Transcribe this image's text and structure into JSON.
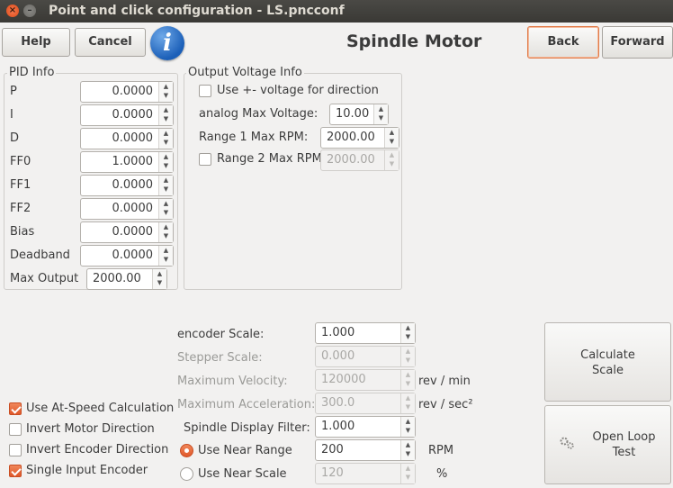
{
  "window": {
    "title": "Point and click configuration - LS.pncconf",
    "close_glyph": "×",
    "minimize_glyph": "–"
  },
  "toolbar": {
    "help_label": "Help",
    "cancel_label": "Cancel",
    "info_glyph": "i",
    "page_title": "Spindle Motor",
    "back_label": "Back",
    "forward_label": "Forward"
  },
  "pid": {
    "frame_label": "PID Info",
    "rows": [
      {
        "label": "P",
        "value": "0.0000"
      },
      {
        "label": "I",
        "value": "0.0000"
      },
      {
        "label": "D",
        "value": "0.0000"
      },
      {
        "label": "FF0",
        "value": "1.0000"
      },
      {
        "label": "FF1",
        "value": "0.0000"
      },
      {
        "label": "FF2",
        "value": "0.0000"
      },
      {
        "label": "Bias",
        "value": "0.0000"
      },
      {
        "label": "Deadband",
        "value": "0.0000"
      }
    ],
    "max_output_label": "Max Output",
    "max_output_value": "2000.00"
  },
  "output_voltage": {
    "frame_label": "Output Voltage Info",
    "use_pm_voltage_label": "Use +- voltage for direction",
    "use_pm_voltage_checked": false,
    "analog_max_voltage_label": "analog Max Voltage:",
    "analog_max_voltage_value": "10.00",
    "range1_label": "Range 1 Max RPM:",
    "range1_value": "2000.00",
    "range2_label": "Range 2 Max RPM",
    "range2_checked": false,
    "range2_value": "2000.00"
  },
  "scale": {
    "encoder_scale_label": "encoder Scale:",
    "encoder_scale_value": "1.000",
    "stepper_scale_label": "Stepper Scale:",
    "stepper_scale_value": "0.000",
    "max_velocity_label": "Maximum Velocity:",
    "max_velocity_value": "120000",
    "max_velocity_unit": "rev / min",
    "max_accel_label": "Maximum Acceleration:",
    "max_accel_value": "300.0",
    "max_accel_unit": "rev / sec²",
    "display_filter_label": "Spindle Display Filter:",
    "display_filter_value": "1.000",
    "near_range_label": "Use Near Range",
    "near_range_value": "200",
    "near_range_unit": "RPM",
    "near_range_selected": true,
    "near_scale_label": "Use Near Scale",
    "near_scale_value": "120",
    "near_scale_unit": "%",
    "near_scale_selected": false
  },
  "options": {
    "at_speed_label": "Use At-Speed Calculation",
    "at_speed_checked": true,
    "invert_motor_label": "Invert Motor Direction",
    "invert_motor_checked": false,
    "invert_encoder_label": "Invert Encoder Direction",
    "invert_encoder_checked": false,
    "single_input_label": "Single Input Encoder",
    "single_input_checked": true
  },
  "actions": {
    "calculate_scale_line1": "Calculate",
    "calculate_scale_line2": "Scale",
    "open_loop_line1": "Open Loop",
    "open_loop_line2": "Test",
    "open_loop_icon": "gear-icon"
  },
  "colors": {
    "accent": "#e0582a",
    "title_bar": "#3c3b37",
    "window_bg": "#f2f1f0"
  }
}
